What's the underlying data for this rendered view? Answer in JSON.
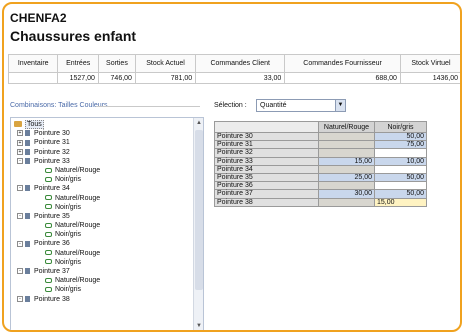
{
  "header": {
    "code": "CHENFA2",
    "name": "Chaussures enfant"
  },
  "summary": {
    "columns": [
      "Inventaire",
      "Entrées",
      "Sorties",
      "Stock Actuel",
      "Commandes Client",
      "Commandes Fournisseur",
      "Stock Virtuel"
    ],
    "values": [
      "",
      "1527,00",
      "746,00",
      "781,00",
      "33,00",
      "688,00",
      "1436,00"
    ]
  },
  "left_panel": {
    "label": "Combinaisons: Tailles Couleurs",
    "tree": [
      {
        "level": "root",
        "label": "Tous",
        "icon": "folder-icon",
        "selected": true
      },
      {
        "level": "level1",
        "label": "Pointure 30",
        "expander": "+"
      },
      {
        "level": "level1",
        "label": "Pointure 31",
        "expander": "+"
      },
      {
        "level": "level1",
        "label": "Pointure 32",
        "expander": "+"
      },
      {
        "level": "level1",
        "label": "Pointure 33",
        "expander": "-"
      },
      {
        "level": "level2",
        "label": "Naturel/Rouge"
      },
      {
        "level": "level2",
        "label": "Noir/gris"
      },
      {
        "level": "level1",
        "label": "Pointure 34",
        "expander": "-"
      },
      {
        "level": "level2",
        "label": "Naturel/Rouge"
      },
      {
        "level": "level2",
        "label": "Noir/gris"
      },
      {
        "level": "level1",
        "label": "Pointure 35",
        "expander": "-"
      },
      {
        "level": "level2",
        "label": "Naturel/Rouge"
      },
      {
        "level": "level2",
        "label": "Noir/gris"
      },
      {
        "level": "level1",
        "label": "Pointure 36",
        "expander": "-"
      },
      {
        "level": "level2",
        "label": "Naturel/Rouge"
      },
      {
        "level": "level2",
        "label": "Noir/gris"
      },
      {
        "level": "level1",
        "label": "Pointure 37",
        "expander": "-"
      },
      {
        "level": "level2",
        "label": "Naturel/Rouge"
      },
      {
        "level": "level2",
        "label": "Noir/gris"
      },
      {
        "level": "level1",
        "label": "Pointure 38",
        "expander": "-"
      }
    ]
  },
  "right_panel": {
    "selection_label": "Sélection :",
    "selection_value": "Quantité",
    "grid": {
      "columns": [
        "Naturel/Rouge",
        "Noir/gris"
      ],
      "rows": [
        {
          "label": "Pointure 30",
          "v1": "",
          "v2": "50,00"
        },
        {
          "label": "Pointure 31",
          "v1": "",
          "v2": "75,00"
        },
        {
          "label": "Pointure 32",
          "v1": "",
          "v2": ""
        },
        {
          "label": "Pointure 33",
          "v1": "15,00",
          "v2": "10,00"
        },
        {
          "label": "Pointure 34",
          "v1": "",
          "v2": ""
        },
        {
          "label": "Pointure 35",
          "v1": "25,00",
          "v2": "50,00"
        },
        {
          "label": "Pointure 36",
          "v1": "",
          "v2": ""
        },
        {
          "label": "Pointure 37",
          "v1": "30,00",
          "v2": "50,00"
        },
        {
          "label": "Pointure 38",
          "v1": "",
          "v2": "15,00"
        }
      ]
    }
  },
  "colors": {
    "frame_border": "#f0a21f",
    "link_blue": "#4a6aa8",
    "cell_beige": "#d8d6cf",
    "cell_blue": "#c9d7ec",
    "cell_yellow": "#fff3c2"
  }
}
